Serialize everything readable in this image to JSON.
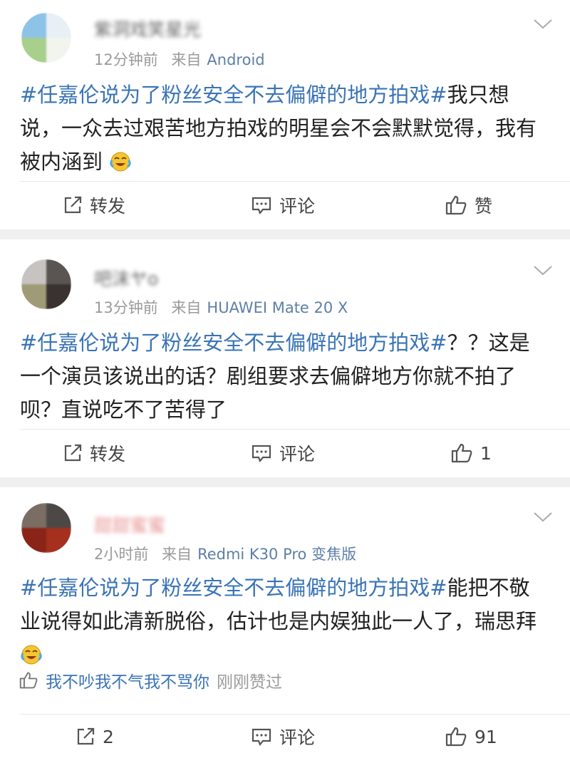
{
  "posts": [
    {
      "username": "紫洞戏笑星光",
      "time": "12分钟前",
      "source_prefix": "来自",
      "source": "Android",
      "topic": "#任嘉伦说为了粉丝安全不去偏僻的地方拍戏#",
      "body": "我只想说，一众去过艰苦地方拍戏的明星会不会默默觉得，我有被内涵到",
      "emoji": "laugh-cry-emoji",
      "repost": "转发",
      "comment": "评论",
      "like": "赞"
    },
    {
      "username": "吧沫ヤo",
      "time": "13分钟前",
      "source_prefix": "来自",
      "source": "HUAWEI Mate 20 X",
      "topic": "#任嘉伦说为了粉丝安全不去偏僻的地方拍戏#",
      "body": "？？这是一个演员该说出的话？剧组要求去偏僻地方你就不拍了呗？直说吃不了苦得了",
      "repost": "转发",
      "comment": "评论",
      "like": "1"
    },
    {
      "username": "甜甜蜜蜜",
      "time": "2小时前",
      "source_prefix": "来自",
      "source": "Redmi K30 Pro 变焦版",
      "topic": "#任嘉伦说为了粉丝安全不去偏僻的地方拍戏#",
      "body": "能把不敬业说得如此清新脱俗，估计也是内娱独此一人了，瑞思拜",
      "emoji": "laugh-cry-emoji",
      "liked_by": "我不吵我不气我不骂你",
      "liked_suffix": "刚刚赞过",
      "repost": "2",
      "comment": "评论",
      "like": "91"
    }
  ],
  "colors": {
    "topic": "#3a74b6",
    "source": "#5d7fa6",
    "meta": "#9a9a9a",
    "separator": "#f0f0f0"
  }
}
